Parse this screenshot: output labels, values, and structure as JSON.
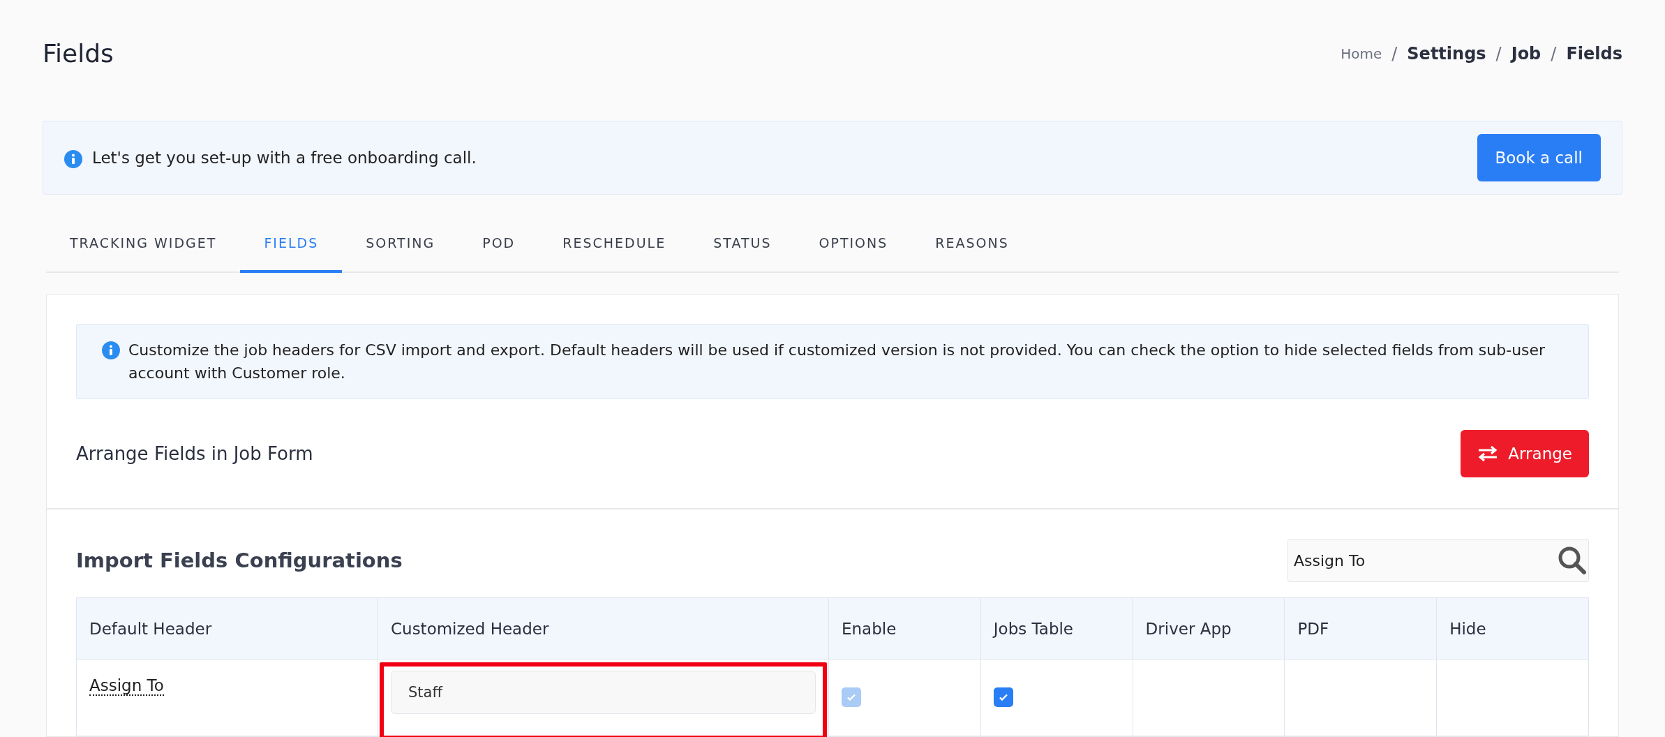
{
  "page": {
    "title": "Fields"
  },
  "breadcrumb": [
    {
      "kind": "link",
      "label": "Home",
      "current": false
    },
    {
      "kind": "separator",
      "label": "/"
    },
    {
      "kind": "link",
      "label": "Settings",
      "current": true
    },
    {
      "kind": "separator",
      "label": "/"
    },
    {
      "kind": "link",
      "label": "Job",
      "current": true
    },
    {
      "kind": "separator",
      "label": "/"
    },
    {
      "kind": "link",
      "label": "Fields",
      "current": true
    }
  ],
  "onboarding": {
    "message": "Let's get you set-up with a free onboarding call.",
    "button": "Book a call"
  },
  "tabs": [
    {
      "label": "TRACKING WIDGET",
      "selected": false
    },
    {
      "label": "FIELDS",
      "selected": true
    },
    {
      "label": "SORTING",
      "selected": false
    },
    {
      "label": "POD",
      "selected": false
    },
    {
      "label": "RESCHEDULE",
      "selected": false
    },
    {
      "label": "STATUS",
      "selected": false
    },
    {
      "label": "OPTIONS",
      "selected": false
    },
    {
      "label": "REASONS",
      "selected": false
    }
  ],
  "info": "Customize the job headers for CSV import and export. Default headers will be used if customized version is not provided. You can check the option to hide selected fields from sub-user account with Customer role.",
  "arrange": {
    "title": "Arrange Fields in Job Form",
    "button": "Arrange"
  },
  "import": {
    "title": "Import Fields Configurations",
    "search": {
      "value": "Assign To"
    },
    "columns": [
      "Default Header",
      "Customized Header",
      "Enable",
      "Jobs Table",
      "Driver App",
      "PDF",
      "Hide"
    ],
    "rows": [
      {
        "default_header": "Assign To",
        "customized_header": "Staff",
        "highlighted": true,
        "enable": {
          "checked": true,
          "disabled": true
        },
        "jobs_table": {
          "checked": true,
          "disabled": false
        }
      }
    ]
  }
}
